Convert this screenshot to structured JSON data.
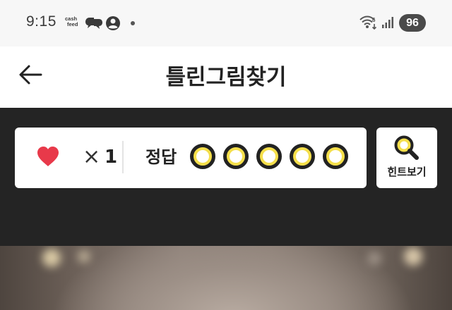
{
  "status_bar": {
    "time": "9:15",
    "cash_line1": "cash",
    "cash_line2": "feed",
    "battery": "96"
  },
  "header": {
    "title": "틀린그림찾기"
  },
  "game": {
    "lives_times": "×",
    "lives_count": "1",
    "answer_label": "정답",
    "answer_slots": 5,
    "hint_label": "힌트보기",
    "accent_color": "#f5df4b",
    "heart_color": "#e8394a"
  }
}
